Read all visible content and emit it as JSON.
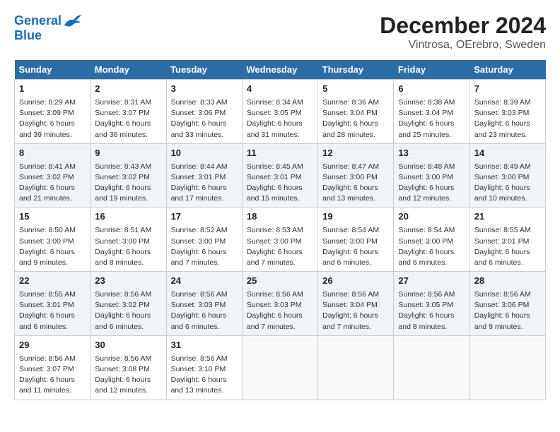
{
  "header": {
    "logo_line1": "General",
    "logo_line2": "Blue",
    "title": "December 2024",
    "subtitle": "Vintrosa, OErebro, Sweden"
  },
  "days_of_week": [
    "Sunday",
    "Monday",
    "Tuesday",
    "Wednesday",
    "Thursday",
    "Friday",
    "Saturday"
  ],
  "weeks": [
    [
      {
        "day": "1",
        "lines": [
          "Sunrise: 8:29 AM",
          "Sunset: 3:09 PM",
          "Daylight: 6 hours",
          "and 39 minutes."
        ]
      },
      {
        "day": "2",
        "lines": [
          "Sunrise: 8:31 AM",
          "Sunset: 3:07 PM",
          "Daylight: 6 hours",
          "and 36 minutes."
        ]
      },
      {
        "day": "3",
        "lines": [
          "Sunrise: 8:33 AM",
          "Sunset: 3:06 PM",
          "Daylight: 6 hours",
          "and 33 minutes."
        ]
      },
      {
        "day": "4",
        "lines": [
          "Sunrise: 8:34 AM",
          "Sunset: 3:05 PM",
          "Daylight: 6 hours",
          "and 31 minutes."
        ]
      },
      {
        "day": "5",
        "lines": [
          "Sunrise: 8:36 AM",
          "Sunset: 3:04 PM",
          "Daylight: 6 hours",
          "and 28 minutes."
        ]
      },
      {
        "day": "6",
        "lines": [
          "Sunrise: 8:38 AM",
          "Sunset: 3:04 PM",
          "Daylight: 6 hours",
          "and 25 minutes."
        ]
      },
      {
        "day": "7",
        "lines": [
          "Sunrise: 8:39 AM",
          "Sunset: 3:03 PM",
          "Daylight: 6 hours",
          "and 23 minutes."
        ]
      }
    ],
    [
      {
        "day": "8",
        "lines": [
          "Sunrise: 8:41 AM",
          "Sunset: 3:02 PM",
          "Daylight: 6 hours",
          "and 21 minutes."
        ]
      },
      {
        "day": "9",
        "lines": [
          "Sunrise: 8:43 AM",
          "Sunset: 3:02 PM",
          "Daylight: 6 hours",
          "and 19 minutes."
        ]
      },
      {
        "day": "10",
        "lines": [
          "Sunrise: 8:44 AM",
          "Sunset: 3:01 PM",
          "Daylight: 6 hours",
          "and 17 minutes."
        ]
      },
      {
        "day": "11",
        "lines": [
          "Sunrise: 8:45 AM",
          "Sunset: 3:01 PM",
          "Daylight: 6 hours",
          "and 15 minutes."
        ]
      },
      {
        "day": "12",
        "lines": [
          "Sunrise: 8:47 AM",
          "Sunset: 3:00 PM",
          "Daylight: 6 hours",
          "and 13 minutes."
        ]
      },
      {
        "day": "13",
        "lines": [
          "Sunrise: 8:48 AM",
          "Sunset: 3:00 PM",
          "Daylight: 6 hours",
          "and 12 minutes."
        ]
      },
      {
        "day": "14",
        "lines": [
          "Sunrise: 8:49 AM",
          "Sunset: 3:00 PM",
          "Daylight: 6 hours",
          "and 10 minutes."
        ]
      }
    ],
    [
      {
        "day": "15",
        "lines": [
          "Sunrise: 8:50 AM",
          "Sunset: 3:00 PM",
          "Daylight: 6 hours",
          "and 9 minutes."
        ]
      },
      {
        "day": "16",
        "lines": [
          "Sunrise: 8:51 AM",
          "Sunset: 3:00 PM",
          "Daylight: 6 hours",
          "and 8 minutes."
        ]
      },
      {
        "day": "17",
        "lines": [
          "Sunrise: 8:52 AM",
          "Sunset: 3:00 PM",
          "Daylight: 6 hours",
          "and 7 minutes."
        ]
      },
      {
        "day": "18",
        "lines": [
          "Sunrise: 8:53 AM",
          "Sunset: 3:00 PM",
          "Daylight: 6 hours",
          "and 7 minutes."
        ]
      },
      {
        "day": "19",
        "lines": [
          "Sunrise: 8:54 AM",
          "Sunset: 3:00 PM",
          "Daylight: 6 hours",
          "and 6 minutes."
        ]
      },
      {
        "day": "20",
        "lines": [
          "Sunrise: 8:54 AM",
          "Sunset: 3:00 PM",
          "Daylight: 6 hours",
          "and 6 minutes."
        ]
      },
      {
        "day": "21",
        "lines": [
          "Sunrise: 8:55 AM",
          "Sunset: 3:01 PM",
          "Daylight: 6 hours",
          "and 6 minutes."
        ]
      }
    ],
    [
      {
        "day": "22",
        "lines": [
          "Sunrise: 8:55 AM",
          "Sunset: 3:01 PM",
          "Daylight: 6 hours",
          "and 6 minutes."
        ]
      },
      {
        "day": "23",
        "lines": [
          "Sunrise: 8:56 AM",
          "Sunset: 3:02 PM",
          "Daylight: 6 hours",
          "and 6 minutes."
        ]
      },
      {
        "day": "24",
        "lines": [
          "Sunrise: 8:56 AM",
          "Sunset: 3:03 PM",
          "Daylight: 6 hours",
          "and 6 minutes."
        ]
      },
      {
        "day": "25",
        "lines": [
          "Sunrise: 8:56 AM",
          "Sunset: 3:03 PM",
          "Daylight: 6 hours",
          "and 7 minutes."
        ]
      },
      {
        "day": "26",
        "lines": [
          "Sunrise: 8:56 AM",
          "Sunset: 3:04 PM",
          "Daylight: 6 hours",
          "and 7 minutes."
        ]
      },
      {
        "day": "27",
        "lines": [
          "Sunrise: 8:56 AM",
          "Sunset: 3:05 PM",
          "Daylight: 6 hours",
          "and 8 minutes."
        ]
      },
      {
        "day": "28",
        "lines": [
          "Sunrise: 8:56 AM",
          "Sunset: 3:06 PM",
          "Daylight: 6 hours",
          "and 9 minutes."
        ]
      }
    ],
    [
      {
        "day": "29",
        "lines": [
          "Sunrise: 8:56 AM",
          "Sunset: 3:07 PM",
          "Daylight: 6 hours",
          "and 11 minutes."
        ]
      },
      {
        "day": "30",
        "lines": [
          "Sunrise: 8:56 AM",
          "Sunset: 3:08 PM",
          "Daylight: 6 hours",
          "and 12 minutes."
        ]
      },
      {
        "day": "31",
        "lines": [
          "Sunrise: 8:56 AM",
          "Sunset: 3:10 PM",
          "Daylight: 6 hours",
          "and 13 minutes."
        ]
      },
      null,
      null,
      null,
      null
    ]
  ]
}
